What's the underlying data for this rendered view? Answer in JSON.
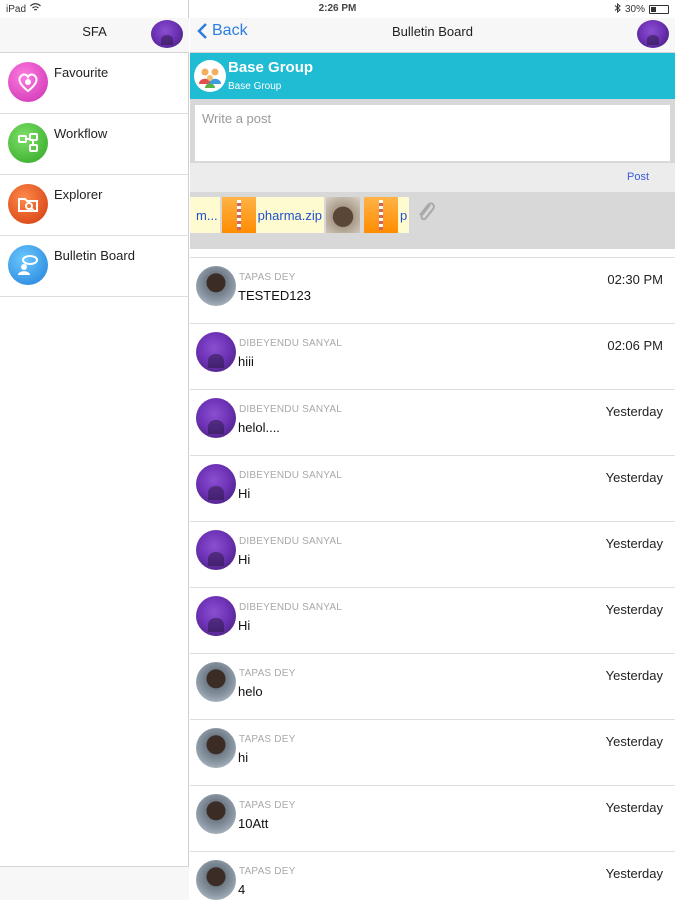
{
  "status_bar": {
    "device": "iPad",
    "time": "2:26 PM",
    "battery": "30%",
    "battery_level": 0.3
  },
  "sidebar": {
    "title": "SFA",
    "items": [
      {
        "label": "Favourite",
        "icon": "heart-icon",
        "color": "#e24fc2"
      },
      {
        "label": "Workflow",
        "icon": "workflow-icon",
        "color": "#4cbf3c"
      },
      {
        "label": "Explorer",
        "icon": "folder-search-icon",
        "color": "#e8531a"
      },
      {
        "label": "Bulletin Board",
        "icon": "bulletin-board-icon",
        "color": "#2d8fe0"
      }
    ]
  },
  "nav": {
    "back_label": "Back",
    "title": "Bulletin Board"
  },
  "group": {
    "name": "Base Group",
    "subtitle": "Base Group",
    "header_color": "#1fbcd3"
  },
  "compose": {
    "placeholder": "Write a post",
    "post_label": "Post",
    "attachments": [
      {
        "type": "file",
        "name": "m..."
      },
      {
        "type": "zip",
        "name": "pharma.zip"
      },
      {
        "type": "image",
        "name": ""
      },
      {
        "type": "zip",
        "name": "p"
      }
    ]
  },
  "posts": [
    {
      "author": "TAPAS DEY",
      "message": "TESTED123",
      "time": "02:30 PM",
      "avatar": "man"
    },
    {
      "author": "DIBEYENDU SANYAL",
      "message": "hiii",
      "time": "02:06 PM",
      "avatar": "purple"
    },
    {
      "author": "DIBEYENDU SANYAL",
      "message": "helol....",
      "time": "Yesterday",
      "avatar": "purple"
    },
    {
      "author": "DIBEYENDU SANYAL",
      "message": "Hi",
      "time": "Yesterday",
      "avatar": "purple"
    },
    {
      "author": "DIBEYENDU SANYAL",
      "message": "Hi",
      "time": "Yesterday",
      "avatar": "purple"
    },
    {
      "author": "DIBEYENDU SANYAL",
      "message": "Hi",
      "time": "Yesterday",
      "avatar": "purple"
    },
    {
      "author": "TAPAS DEY",
      "message": "helo",
      "time": "Yesterday",
      "avatar": "man"
    },
    {
      "author": "TAPAS DEY",
      "message": "hi",
      "time": "Yesterday",
      "avatar": "man"
    },
    {
      "author": "TAPAS DEY",
      "message": "10Att",
      "time": "Yesterday",
      "avatar": "man"
    },
    {
      "author": "TAPAS DEY",
      "message": "4",
      "time": "Yesterday",
      "avatar": "man"
    }
  ]
}
